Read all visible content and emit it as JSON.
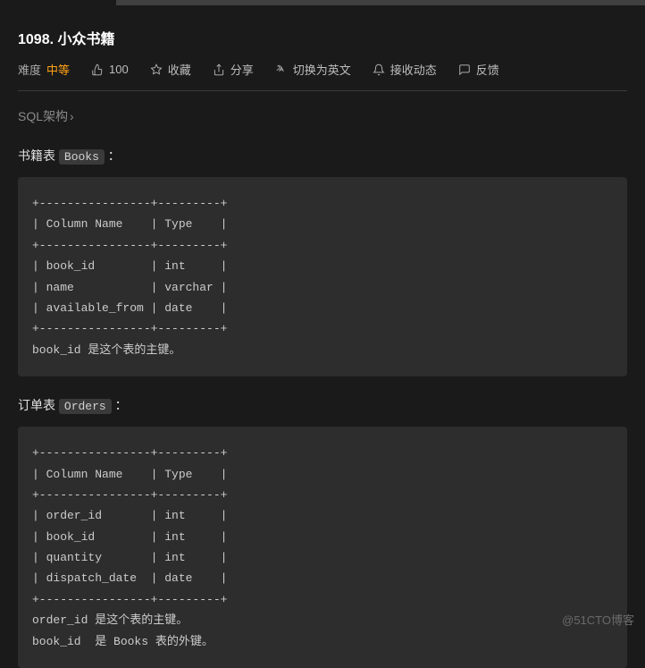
{
  "header": {
    "title": "1098. 小众书籍"
  },
  "meta": {
    "difficulty_label": "难度",
    "difficulty_value": "中等",
    "likes": "100",
    "favorite": "收藏",
    "share": "分享",
    "translate": "切换为英文",
    "subscribe": "接收动态",
    "feedback": "反馈"
  },
  "schema_link": "SQL架构",
  "section1": {
    "prefix": "书籍表 ",
    "code": "Books",
    "suffix": " ："
  },
  "code1": "+----------------+---------+\n| Column Name    | Type    |\n+----------------+---------+\n| book_id        | int     |\n| name           | varchar |\n| available_from | date    |\n+----------------+---------+\nbook_id 是这个表的主键。",
  "section2": {
    "prefix": "订单表 ",
    "code": "Orders",
    "suffix": " ："
  },
  "code2": "+----------------+---------+\n| Column Name    | Type    |\n+----------------+---------+\n| order_id       | int     |\n| book_id        | int     |\n| quantity       | int     |\n| dispatch_date  | date    |\n+----------------+---------+\norder_id 是这个表的主键。\nbook_id  是 Books 表的外键。",
  "watermark": "@51CTO博客"
}
